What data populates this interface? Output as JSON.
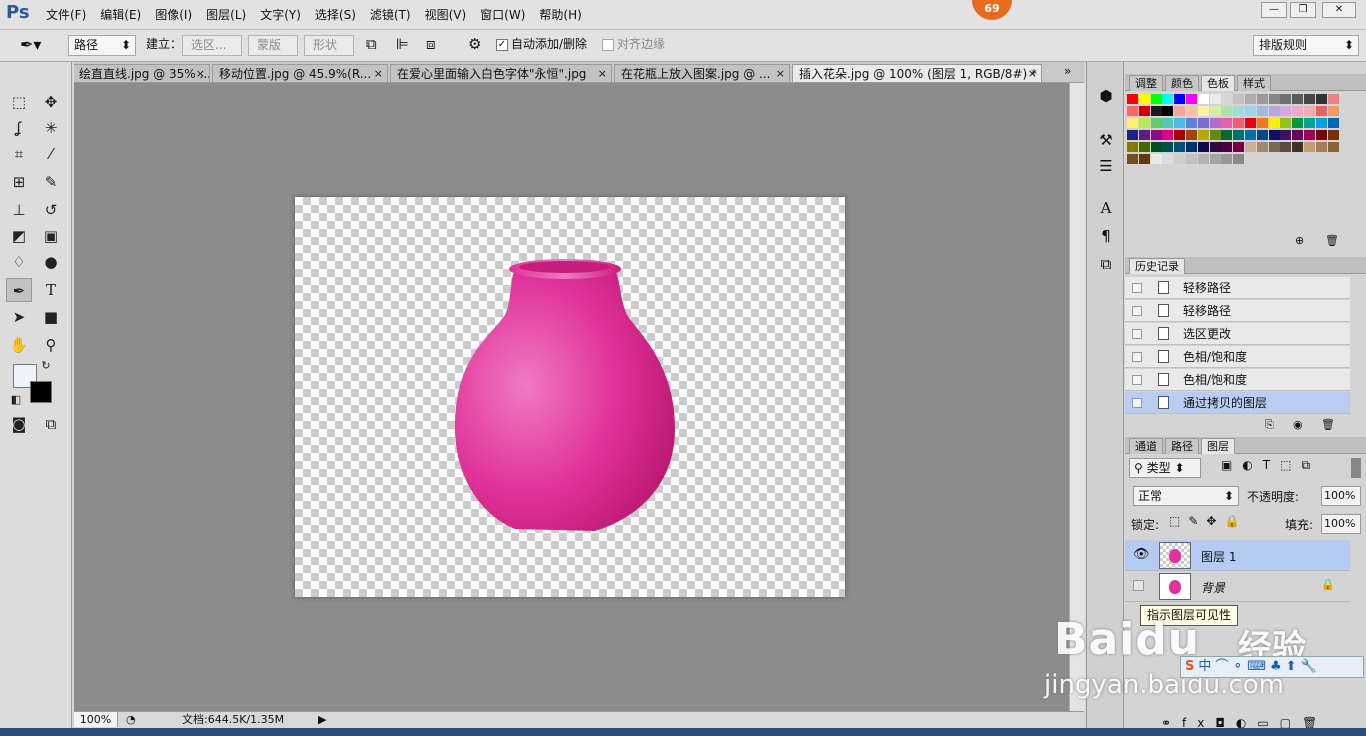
{
  "app": {
    "logo": "Ps",
    "notification_count": "69"
  },
  "menu": [
    "文件(F)",
    "编辑(E)",
    "图像(I)",
    "图层(L)",
    "文字(Y)",
    "选择(S)",
    "滤镜(T)",
    "视图(V)",
    "窗口(W)",
    "帮助(H)"
  ],
  "window_controls": {
    "minimize": "—",
    "restore": "❐",
    "close": "✕"
  },
  "options": {
    "mode_value": "路径",
    "make_label": "建立：",
    "selection_btn": "选区...",
    "mask_btn": "蒙版",
    "shape_btn": "形状",
    "auto_add_label": "自动添加/删除",
    "align_edges_label": "对齐边缘",
    "workspace_value": "排版规则"
  },
  "tabs": [
    {
      "label": "绘直直线.jpg @ 35% ...",
      "active": false
    },
    {
      "label": "移动位置.jpg @ 45.9%(R...",
      "active": false
    },
    {
      "label": "在爱心里面输入白色字体\"永恒\".jpg",
      "active": false
    },
    {
      "label": "在花瓶上放入图案.jpg @ ...",
      "active": false
    },
    {
      "label": "插入花朵.jpg @ 100% (图层 1, RGB/8#) *",
      "active": true
    }
  ],
  "tab_close": "×",
  "tab_overflow": "»",
  "status": {
    "zoom": "100%",
    "doc_info": "文档:644.5K/1.35M"
  },
  "color_panel": {
    "tabs": [
      "调整",
      "颜色",
      "色板",
      "样式"
    ],
    "active": "色板"
  },
  "swatch_colors": [
    "#ff0000",
    "#ffff00",
    "#00ff00",
    "#00ffff",
    "#0000ff",
    "#ff00ff",
    "#ffffff",
    "#ebebeb",
    "#d6d6d6",
    "#c2c2c2",
    "#adadad",
    "#999999",
    "#858585",
    "#707070",
    "#5c5c5c",
    "#474747",
    "#333333",
    "#f08080",
    "#ff6666",
    "#cc0000",
    "#1a1a1a",
    "#000000",
    "#f5a3a3",
    "#f9c49a",
    "#fff3a0",
    "#d7f0a0",
    "#a8e6b0",
    "#9ee0d8",
    "#9fd4f0",
    "#a7b6e8",
    "#b7a5e0",
    "#d7a8e0",
    "#f0a8d0",
    "#f7a8b0",
    "#ee6060",
    "#f59a5e",
    "#fff06a",
    "#bfe65a",
    "#5ccf6a",
    "#55c9b9",
    "#4fb8ec",
    "#5a85d6",
    "#7a6ad1",
    "#b06ad0",
    "#e35fb0",
    "#ec5f75",
    "#e60012",
    "#ef7a1a",
    "#ffee00",
    "#8fc31f",
    "#009944",
    "#00a497",
    "#00a0e9",
    "#0068b7",
    "#1d2088",
    "#601986",
    "#920783",
    "#e4007f",
    "#a40000",
    "#a84200",
    "#b7aa00",
    "#638c0b",
    "#006b33",
    "#007168",
    "#0071a4",
    "#004986",
    "#120f63",
    "#440e62",
    "#690259",
    "#a10058",
    "#7d0000",
    "#7a3000",
    "#847a00",
    "#466506",
    "#004d24",
    "#00514b",
    "#005177",
    "#003361",
    "#0e0a47",
    "#300846",
    "#4b0040",
    "#730040",
    "#c7b299",
    "#9e8a72",
    "#7a6953",
    "#5a4b3a",
    "#3d3327",
    "#c69c6d",
    "#a67c52",
    "#8c6239",
    "#754c24",
    "#603913",
    "#eaeaea",
    "#dcdcdc",
    "#cfcfcf",
    "#c1c1c1",
    "#b3b3b3",
    "#a5a5a5",
    "#979797",
    "#898989"
  ],
  "history_panel": {
    "tab": "历史记录",
    "items": [
      "轻移路径",
      "轻移路径",
      "选区更改",
      "色相/饱和度",
      "色相/饱和度",
      "通过拷贝的图层"
    ],
    "selected_index": 5
  },
  "layers_panel": {
    "tabs": [
      "通道",
      "路径",
      "图层"
    ],
    "active": "图层",
    "filter_kind": "类型",
    "blend_mode": "正常",
    "opacity_label": "不透明度:",
    "opacity_value": "100%",
    "lock_label": "锁定:",
    "fill_label": "填充:",
    "fill_value": "100%",
    "layers": [
      {
        "name": "图层 1",
        "visible": true,
        "selected": true,
        "locked": false
      },
      {
        "name": "背景",
        "visible": false,
        "selected": false,
        "locked": true
      }
    ]
  },
  "tooltip": "指示图层可见性",
  "watermark": {
    "brand": "Baidu",
    "product": "经验",
    "url": "jingyan.baidu.com"
  },
  "vase_colors": {
    "light": "#f07ac0",
    "main": "#e0329a",
    "dark": "#b8166f"
  }
}
